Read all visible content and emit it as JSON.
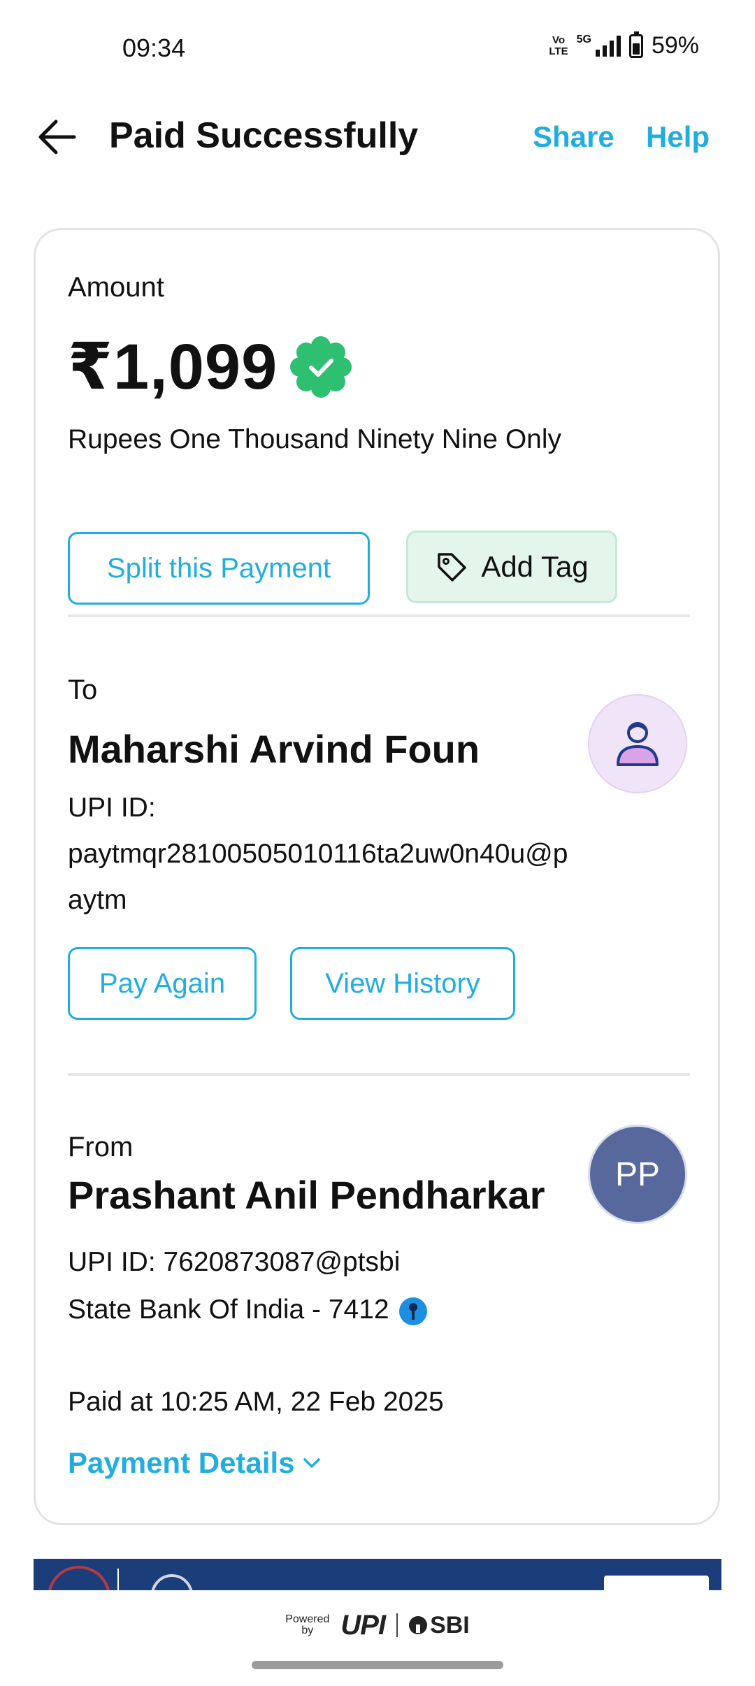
{
  "status_bar": {
    "time": "09:34",
    "volte_top": "Vo",
    "volte_bottom": "LTE",
    "network": "5G",
    "battery": "59%"
  },
  "header": {
    "title": "Paid Successfully",
    "share_label": "Share",
    "help_label": "Help"
  },
  "amount_section": {
    "label": "Amount",
    "value": "₹1,099",
    "words": "Rupees One Thousand Ninety Nine Only",
    "split_button": "Split this Payment",
    "tag_button": "Add Tag"
  },
  "to_section": {
    "label": "To",
    "name": "Maharshi Arvind Foun",
    "upi_label": "UPI ID:",
    "upi_id": "paytmqr28100505010116ta2uw0n40u@paytm",
    "pay_again_button": "Pay Again",
    "view_history_button": "View History"
  },
  "from_section": {
    "label": "From",
    "name": "Prashant Anil Pendharkar",
    "initials": "PP",
    "upi_line": "UPI ID: 7620873087@ptsbi",
    "bank": "State Bank Of India - 7412",
    "paid_at": "Paid at 10:25 AM, 22 Feb 2025",
    "payment_details_link": "Payment Details"
  },
  "footer": {
    "powered_top": "Powered",
    "powered_bottom": "by",
    "upi_brand": "UPI",
    "bank_brand": "SBI"
  },
  "colors": {
    "accent": "#20aee0",
    "verified_green": "#2fbf71",
    "avatar_blue": "#56689c",
    "tag_bg": "#e4f5ec"
  },
  "icons": {
    "back": "arrow-left-icon",
    "verified": "verified-badge-icon",
    "tag": "tag-icon",
    "person": "person-icon",
    "chevron": "chevron-down-icon",
    "bank_logo": "sbi-logo-icon"
  }
}
